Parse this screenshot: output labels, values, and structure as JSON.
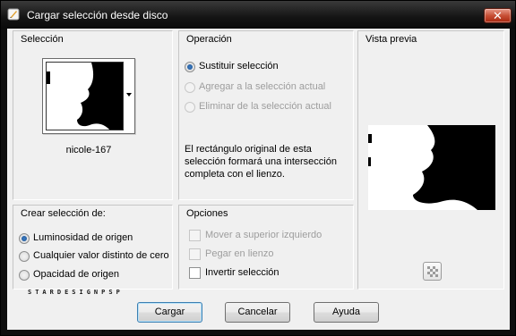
{
  "window": {
    "title": "Cargar selección desde disco"
  },
  "seleccion": {
    "title": "Selección",
    "file_name": "nicole-167"
  },
  "operacion": {
    "title": "Operación",
    "options": [
      {
        "label": "Sustituir selección",
        "checked": true,
        "enabled": true
      },
      {
        "label": "Agregar a la selección actual",
        "checked": false,
        "enabled": false
      },
      {
        "label": "Eliminar de la selección actual",
        "checked": false,
        "enabled": false
      }
    ],
    "description": "El rectángulo original de esta selección formará una intersección completa con el lienzo."
  },
  "vista_previa": {
    "title": "Vista previa"
  },
  "crear_seleccion": {
    "title": "Crear selección de:",
    "options": [
      {
        "label": "Luminosidad de origen",
        "checked": true
      },
      {
        "label": "Cualquier valor distinto de cero",
        "checked": false
      },
      {
        "label": "Opacidad de origen",
        "checked": false
      }
    ]
  },
  "opciones": {
    "title": "Opciones",
    "items": [
      {
        "label": "Mover a superior izquierdo",
        "checked": false,
        "enabled": false
      },
      {
        "label": "Pegar en lienzo",
        "checked": false,
        "enabled": false
      },
      {
        "label": "Invertir selección",
        "checked": false,
        "enabled": true
      }
    ]
  },
  "watermark": "STARDESIGNPSP",
  "buttons": {
    "cargar": "Cargar",
    "cancelar": "Cancelar",
    "ayuda": "Ayuda"
  },
  "icons": {
    "app": "paint-brush-icon",
    "close": "close-icon",
    "preview_toggle": "checkerboard-icon"
  },
  "colors": {
    "close_button": "#c75036",
    "default_button_border": "#3c7fb1",
    "titlebar": "#141414"
  }
}
